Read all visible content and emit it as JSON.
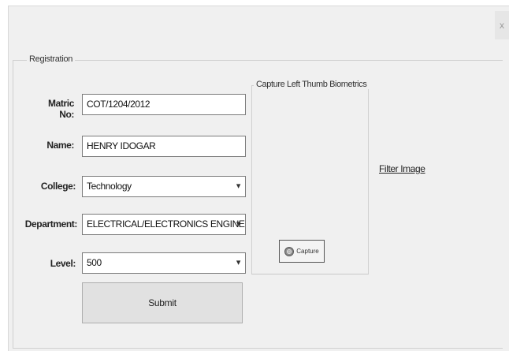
{
  "window": {
    "close_glyph": "x"
  },
  "registration": {
    "legend": "Registration",
    "matric": {
      "label": "Matric No:",
      "value": "COT/1204/2012"
    },
    "name": {
      "label": "Name:",
      "value": "HENRY IDOGAR"
    },
    "college": {
      "label": "College:",
      "value": "Technology"
    },
    "department": {
      "label": "Department:",
      "value": "ELECTRICAL/ELECTRONICS ENGINEERII"
    },
    "level": {
      "label": "Level:",
      "value": "500"
    },
    "submit_label": "Submit"
  },
  "biometrics": {
    "legend": "Capture Left Thumb Biometrics",
    "capture_label": "Capture",
    "capture_icon": "fingerprint-icon"
  },
  "filter_link": "Filter Image"
}
